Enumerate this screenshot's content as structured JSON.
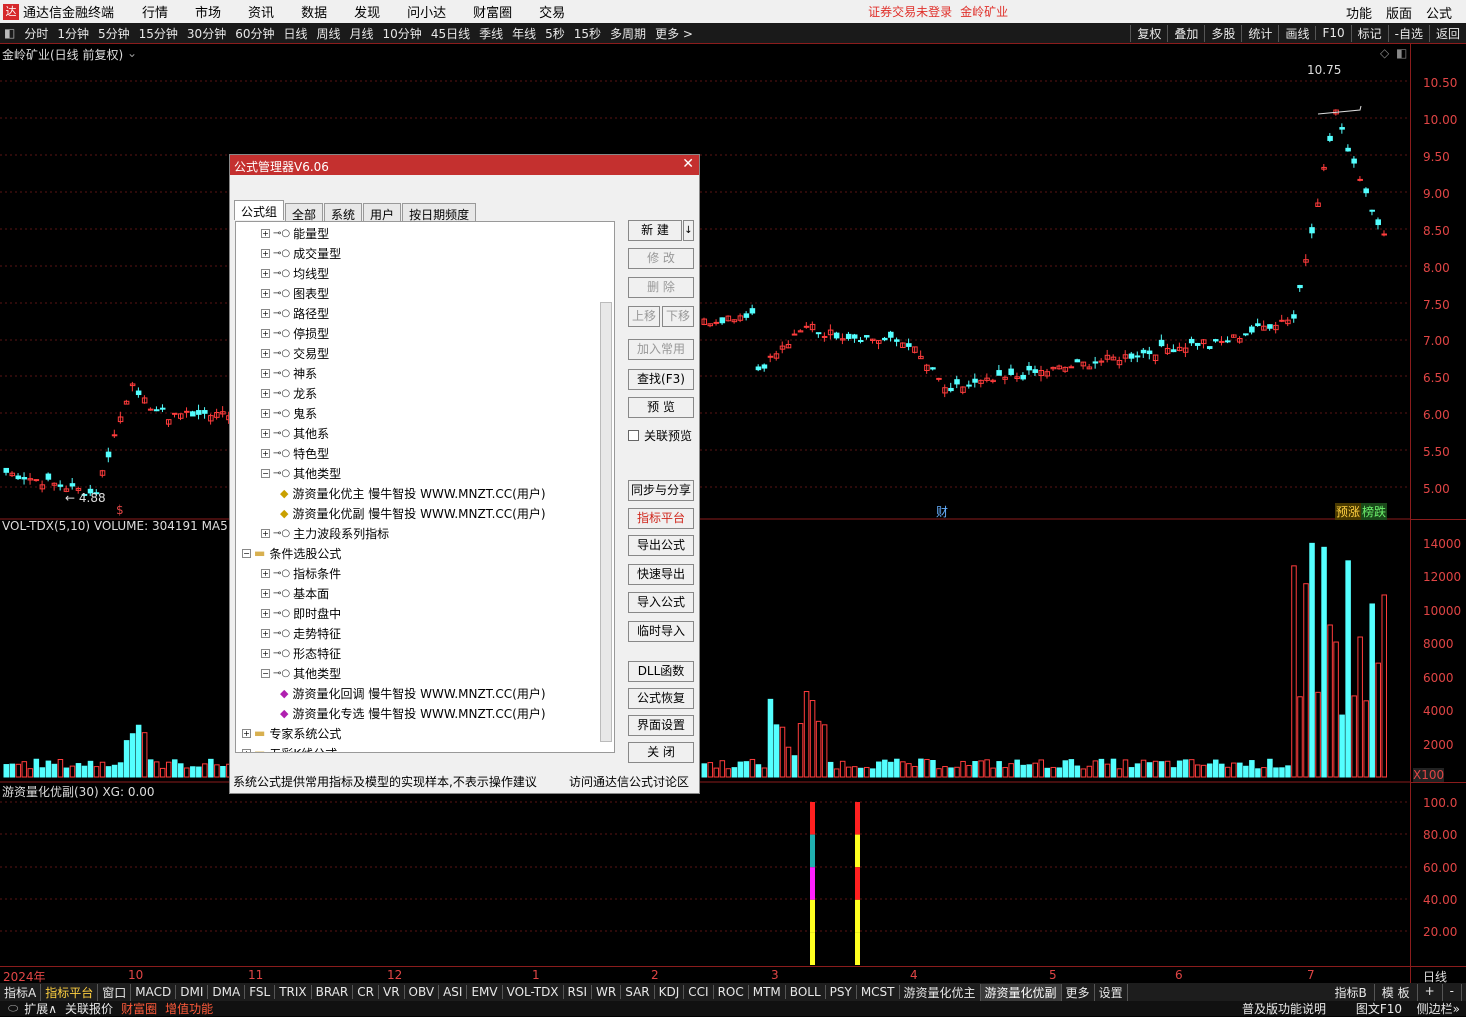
{
  "menubar": {
    "app": "通达信金融终端",
    "items": [
      "行情",
      "市场",
      "资讯",
      "数据",
      "发现",
      "问小达",
      "财富圈",
      "交易"
    ],
    "warning": "证券交易未登录",
    "stock": "金岭矿业",
    "right": [
      "功能",
      "版面",
      "公式"
    ]
  },
  "periodbar": {
    "items": [
      "分时",
      "1分钟",
      "5分钟",
      "15分钟",
      "30分钟",
      "60分钟",
      "日线",
      "周线",
      "月线",
      "10分钟",
      "45日线",
      "季线",
      "年线",
      "5秒",
      "15秒",
      "多周期",
      "更多 >"
    ],
    "right": [
      "复权",
      "叠加",
      "多股",
      "统计",
      "画线",
      "F10",
      "标记",
      "-自选",
      "返回"
    ]
  },
  "chart": {
    "title": "金岭矿业(日线 前复权)",
    "high_label": "10.75",
    "low_label": "← 4.88",
    "price_ticks": [
      "10.50",
      "10.00",
      "9.50",
      "9.00",
      "8.50",
      "8.00",
      "7.50",
      "7.00",
      "6.50",
      "6.00",
      "5.50",
      "5.00"
    ],
    "vol_title": "VOL-TDX(5,10)  VOLUME: 304191  MA5",
    "vol_ticks": [
      "14000",
      "12000",
      "10000",
      "8000",
      "6000",
      "4000",
      "2000"
    ],
    "vol_unit": "X100",
    "ind_title": "游资量化优副(30)  XG: 0.00",
    "ind_ticks": [
      "100.0",
      "80.00",
      "60.00",
      "40.00",
      "20.00"
    ],
    "time_labels": [
      "2024年",
      "10",
      "11",
      "12",
      "1",
      "2",
      "3",
      "4",
      "5",
      "6",
      "7"
    ],
    "right_bottom": "日线",
    "marker_cai": "财",
    "marker_s": "$",
    "marker_yz": "预涨",
    "marker_bd": "榜跌"
  },
  "dialog": {
    "title": "公式管理器V6.06",
    "tabs": [
      "公式组",
      "全部",
      "系统",
      "用户",
      "按日期频度"
    ],
    "tree": [
      {
        "i": 1,
        "t": "能量型",
        "k": "key"
      },
      {
        "i": 1,
        "t": "成交量型",
        "k": "key"
      },
      {
        "i": 1,
        "t": "均线型",
        "k": "key"
      },
      {
        "i": 1,
        "t": "图表型",
        "k": "key"
      },
      {
        "i": 1,
        "t": "路径型",
        "k": "key"
      },
      {
        "i": 1,
        "t": "停损型",
        "k": "key"
      },
      {
        "i": 1,
        "t": "交易型",
        "k": "key"
      },
      {
        "i": 1,
        "t": "神系",
        "k": "key"
      },
      {
        "i": 1,
        "t": "龙系",
        "k": "key"
      },
      {
        "i": 1,
        "t": "鬼系",
        "k": "key"
      },
      {
        "i": 1,
        "t": "其他系",
        "k": "key"
      },
      {
        "i": 1,
        "t": "特色型",
        "k": "key"
      },
      {
        "i": 1,
        "t": "其他类型",
        "k": "key",
        "open": true
      },
      {
        "i": 2,
        "t": "游资量化优主   慢牛智投 WWW.MNZT.CC(用户)",
        "k": "dia"
      },
      {
        "i": 2,
        "t": "游资量化优副   慢牛智投 WWW.MNZT.CC(用户)",
        "k": "dia"
      },
      {
        "i": 1,
        "t": "主力波段系列指标",
        "k": "key"
      },
      {
        "i": 0,
        "t": "条件选股公式",
        "k": "fld",
        "open": true
      },
      {
        "i": 1,
        "t": "指标条件",
        "k": "key"
      },
      {
        "i": 1,
        "t": "基本面",
        "k": "key"
      },
      {
        "i": 1,
        "t": "即时盘中",
        "k": "key"
      },
      {
        "i": 1,
        "t": "走势特征",
        "k": "key"
      },
      {
        "i": 1,
        "t": "形态特征",
        "k": "key"
      },
      {
        "i": 1,
        "t": "其他类型",
        "k": "key",
        "open": true
      },
      {
        "i": 2,
        "t": "游资量化回调   慢牛智投 WWW.MNZT.CC(用户)",
        "k": "dia2"
      },
      {
        "i": 2,
        "t": "游资量化专选   慢牛智投 WWW.MNZT.CC(用户)",
        "k": "dia2"
      },
      {
        "i": 0,
        "t": "专家系统公式",
        "k": "fld"
      },
      {
        "i": 0,
        "t": "五彩K线公式",
        "k": "fld"
      }
    ],
    "buttons": [
      "新  建",
      "修  改",
      "删  除",
      "上移",
      "下移",
      "加入常用",
      "查找(F3)",
      "预  览",
      "同步与分享",
      "指标平台",
      "导出公式",
      "快速导出",
      "导入公式",
      "临时导入",
      "DLL函数",
      "公式恢复",
      "界面设置",
      "关  闭"
    ],
    "check": "关联预览",
    "footer_left": "系统公式提供常用指标及模型的实现样本,不表示操作建议",
    "footer_right": "访问通达信公式讨论区"
  },
  "bottomtabs": [
    "指标A",
    "指标平台",
    "窗口",
    "MACD",
    "DMI",
    "DMA",
    "FSL",
    "TRIX",
    "BRAR",
    "CR",
    "VR",
    "OBV",
    "ASI",
    "EMV",
    "VOL-TDX",
    "RSI",
    "WR",
    "SAR",
    "KDJ",
    "CCI",
    "ROC",
    "MTM",
    "BOLL",
    "PSY",
    "MCST",
    "游资量化优主",
    "游资量化优副",
    "更多",
    "设置"
  ],
  "bottomright": [
    "指标B",
    "模 板",
    "+",
    "-"
  ],
  "status": [
    "扩展∧",
    "关联报价",
    "财富圈",
    "增值功能"
  ],
  "status_right": [
    "普及版功能说明",
    "图文F10",
    "侧边栏»"
  ],
  "chart_data": {
    "type": "candlestick",
    "title": "金岭矿业(日线 前复权)",
    "high": 10.75,
    "low": 4.88,
    "ylim": [
      4.7,
      10.75
    ]
  }
}
